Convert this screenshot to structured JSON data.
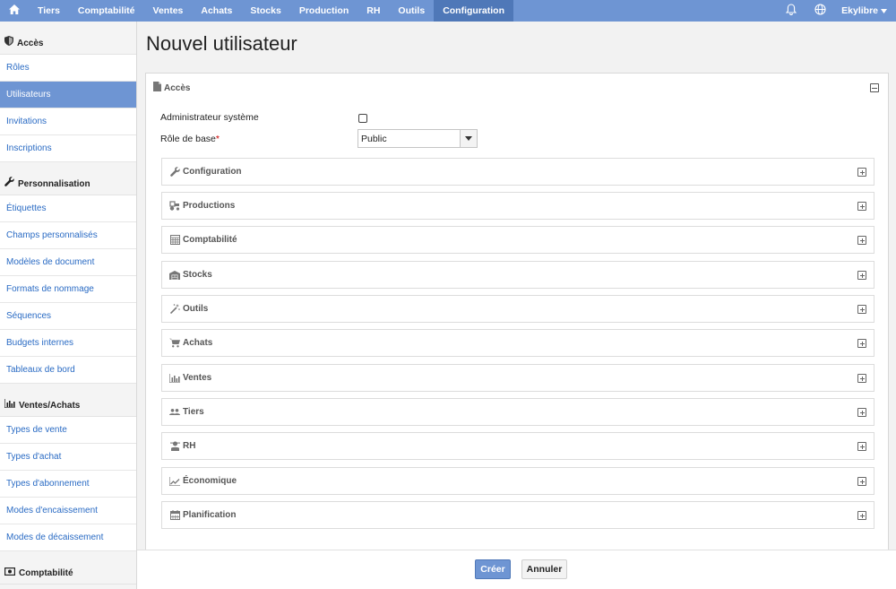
{
  "topnav": {
    "home_icon": "home-icon",
    "items": [
      "Tiers",
      "Comptabilité",
      "Ventes",
      "Achats",
      "Stocks",
      "Production",
      "RH",
      "Outils",
      "Configuration"
    ],
    "active": "Configuration",
    "user": "Ekylibre",
    "accent": "#6e95d3"
  },
  "sidebar": {
    "sections": [
      {
        "title": "Accès",
        "icon": "shield-icon",
        "items": [
          "Rôles",
          "Utilisateurs",
          "Invitations",
          "Inscriptions"
        ]
      },
      {
        "title": "Personnalisation",
        "icon": "wrench-icon",
        "items": [
          "Étiquettes",
          "Champs personnalisés",
          "Modèles de document",
          "Formats de nommage",
          "Séquences",
          "Budgets internes",
          "Tableaux de bord"
        ]
      },
      {
        "title": "Ventes/Achats",
        "icon": "bar-chart-icon",
        "items": [
          "Types de vente",
          "Types d'achat",
          "Types d'abonnement",
          "Modes d'encaissement",
          "Modes de décaissement"
        ]
      },
      {
        "title": "Comptabilité",
        "icon": "money-icon",
        "items": []
      }
    ],
    "active_item": "Utilisateurs"
  },
  "main": {
    "title": "Nouvel utilisateur",
    "panel_title": "Accès",
    "admin_label": "Administrateur système",
    "admin_checked": false,
    "role_label": "Rôle de base",
    "role_required_mark": "*",
    "role_value": "Public",
    "sub_panels": [
      {
        "label": "Configuration",
        "icon": "wrench-icon"
      },
      {
        "label": "Productions",
        "icon": "tractor-icon"
      },
      {
        "label": "Comptabilité",
        "icon": "calculator-icon"
      },
      {
        "label": "Stocks",
        "icon": "warehouse-icon"
      },
      {
        "label": "Outils",
        "icon": "magic-wand-icon"
      },
      {
        "label": "Achats",
        "icon": "cart-icon"
      },
      {
        "label": "Ventes",
        "icon": "bar-chart-icon"
      },
      {
        "label": "Tiers",
        "icon": "people-icon"
      },
      {
        "label": "RH",
        "icon": "person-icon"
      },
      {
        "label": "Économique",
        "icon": "trend-icon"
      },
      {
        "label": "Planification",
        "icon": "calendar-icon"
      }
    ]
  },
  "footer": {
    "create_label": "Créer",
    "cancel_label": "Annuler"
  }
}
